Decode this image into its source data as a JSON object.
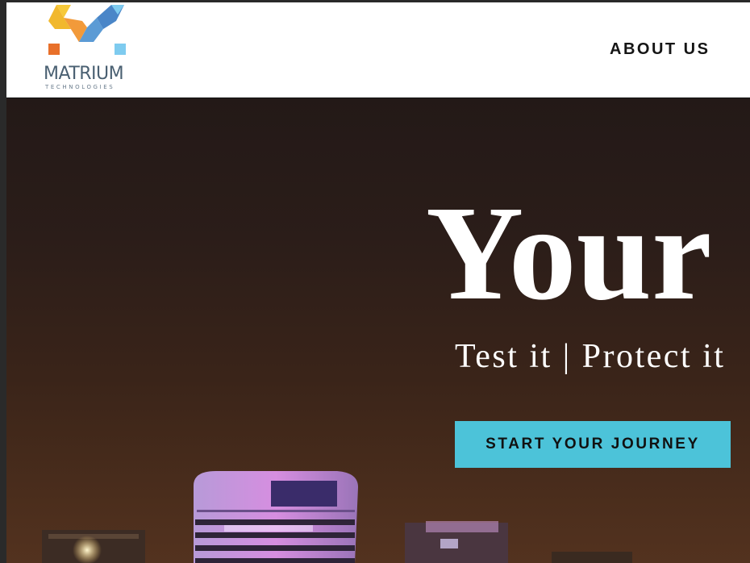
{
  "header": {
    "logo": {
      "name": "MATRIUM",
      "tagline": "TECHNOLOGIES",
      "mark_icon": "matrium-m-icon",
      "colors": [
        "#f1b82d",
        "#e8702a",
        "#5b9bd5",
        "#7ecbef"
      ]
    },
    "nav": [
      {
        "label": "ABOUT US"
      }
    ]
  },
  "hero": {
    "title": "Your",
    "subtitle": "Test it | Protect it",
    "cta_label": "START YOUR JOURNEY",
    "background": "night city skyline",
    "accent_color": "#4cc3d9"
  }
}
